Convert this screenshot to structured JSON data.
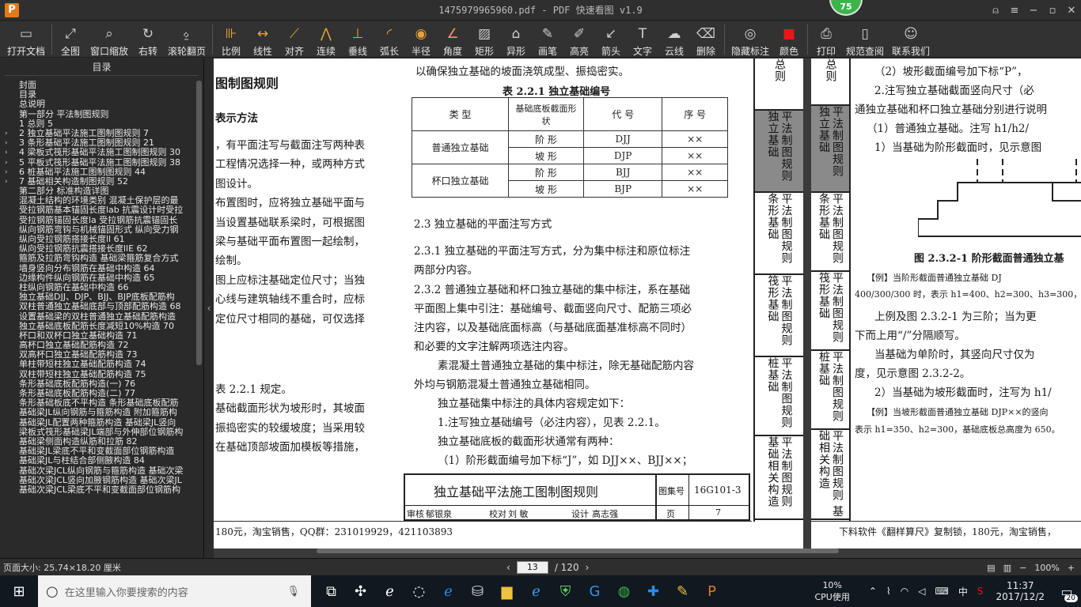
{
  "window": {
    "title": "1475979965960.pdf - PDF 快速看图 v1.9",
    "badge": "75"
  },
  "toolbar": [
    {
      "label": "打开文档",
      "icon": "folder-icon",
      "glyph": "▭"
    },
    {
      "label": "全图",
      "icon": "fit-page-icon",
      "glyph": "⤢"
    },
    {
      "label": "窗口缩放",
      "icon": "zoom-window-icon",
      "glyph": "⌕"
    },
    {
      "label": "右转",
      "icon": "rotate-right-icon",
      "glyph": "↻"
    },
    {
      "label": "滚轮翻页",
      "icon": "mouse-wheel-icon",
      "glyph": "⍚"
    },
    {
      "label": "比例",
      "icon": "scale-icon",
      "glyph": "⊪"
    },
    {
      "label": "线性",
      "icon": "linear-icon",
      "glyph": "↔"
    },
    {
      "label": "对齐",
      "icon": "align-icon",
      "glyph": "⟋"
    },
    {
      "label": "连续",
      "icon": "continuous-icon",
      "glyph": "⋀"
    },
    {
      "label": "垂线",
      "icon": "perpendicular-icon",
      "glyph": "⊥"
    },
    {
      "label": "弧长",
      "icon": "arc-length-icon",
      "glyph": "◜"
    },
    {
      "label": "半径",
      "icon": "radius-icon",
      "glyph": "◉"
    },
    {
      "label": "角度",
      "icon": "angle-icon",
      "glyph": "∠"
    },
    {
      "label": "矩形",
      "icon": "rectangle-icon",
      "glyph": "▨"
    },
    {
      "label": "异形",
      "icon": "polygon-icon",
      "glyph": "⌂"
    },
    {
      "label": "画笔",
      "icon": "pen-icon",
      "glyph": "✎"
    },
    {
      "label": "高亮",
      "icon": "highlighter-icon",
      "glyph": "✐"
    },
    {
      "label": "箭头",
      "icon": "arrow-icon",
      "glyph": "↙"
    },
    {
      "label": "文字",
      "icon": "text-icon",
      "glyph": "T"
    },
    {
      "label": "云线",
      "icon": "cloud-icon",
      "glyph": "☁"
    },
    {
      "label": "删除",
      "icon": "eraser-icon",
      "glyph": "⌫"
    },
    {
      "label": "隐藏标注",
      "icon": "hide-eye-icon",
      "glyph": "◎"
    },
    {
      "label": "颜色",
      "icon": "color-swatch-icon",
      "glyph": "■"
    },
    {
      "label": "打印",
      "icon": "printer-icon",
      "glyph": "⎙"
    },
    {
      "label": "规范查阅",
      "icon": "book-icon",
      "glyph": "▯"
    },
    {
      "label": "联系我们",
      "icon": "contact-icon",
      "glyph": "☺"
    }
  ],
  "colors": {
    "accent_orange": "#e8a23c",
    "color_red": "#e8161a",
    "badge_green": "#3cb44a"
  },
  "sidebar": {
    "title": "目录",
    "items": [
      {
        "t": "封面",
        "a": ""
      },
      {
        "t": "目录",
        "a": ""
      },
      {
        "t": "总说明",
        "a": ""
      },
      {
        "t": "第一部分  平法制图规则",
        "a": ""
      },
      {
        "t": "1 总则 5",
        "a": ""
      },
      {
        "t": "2 独立基础平法施工图制图规则 7",
        "a": "›"
      },
      {
        "t": "3 条形基础平法施工图制图规则 21",
        "a": "›"
      },
      {
        "t": "4 梁板式筏形基础平法施工图制图规则 30",
        "a": "›"
      },
      {
        "t": "5 平板式筏形基础平法施工图制图规则 38",
        "a": "›"
      },
      {
        "t": "6 桩基础平法施工图制图规则 44",
        "a": "›"
      },
      {
        "t": "7 基础相关构造制图规则 52",
        "a": "›"
      },
      {
        "t": "第二部分  标准构造详图",
        "a": ""
      },
      {
        "t": "混凝土结构的环境类别 混凝土保护层的最",
        "a": ""
      },
      {
        "t": "受拉钢筋基本锚固长度lab 抗震设计时受拉",
        "a": ""
      },
      {
        "t": "受拉钢筋锚固长度la 受拉钢筋抗震锚固长",
        "a": ""
      },
      {
        "t": "纵向钢筋弯钩与机械锚固形式 纵向受力钢",
        "a": ""
      },
      {
        "t": "纵向受拉钢筋搭接长度ll 61",
        "a": ""
      },
      {
        "t": "纵向受拉钢筋抗震搭接长度llE 62",
        "a": ""
      },
      {
        "t": "箍筋及拉筋弯钩构造 基础梁箍筋复合方式",
        "a": ""
      },
      {
        "t": "墙身竖向分布钢筋在基础中构造 64",
        "a": ""
      },
      {
        "t": "边缘构件纵向钢筋在基础中构造 65",
        "a": ""
      },
      {
        "t": "柱纵向钢筋在基础中构造 66",
        "a": ""
      },
      {
        "t": "独立基础DJJ、DJP、BJJ、BJP底板配筋构",
        "a": ""
      },
      {
        "t": "双柱普通独立基础底部与顶部配筋构造 68",
        "a": ""
      },
      {
        "t": "设置基础梁的双柱普通独立基础配筋构造",
        "a": ""
      },
      {
        "t": "独立基础底板配筋长度减短10%构造 70",
        "a": ""
      },
      {
        "t": "杯口和双杯口独立基础构造 71",
        "a": ""
      },
      {
        "t": "高杯口独立基础配筋构造 72",
        "a": ""
      },
      {
        "t": "双高杯口独立基础配筋构造 73",
        "a": ""
      },
      {
        "t": "单柱带短柱独立基础配筋构造 74",
        "a": ""
      },
      {
        "t": "双柱带短柱独立基础配筋构造 75",
        "a": ""
      },
      {
        "t": "条形基础底板配筋构造(一) 76",
        "a": ""
      },
      {
        "t": "条形基础底板配筋构造(二) 77",
        "a": ""
      },
      {
        "t": "条形基础板底不平构造 条形基础底板配筋",
        "a": ""
      },
      {
        "t": "基础梁JL纵向钢筋与箍筋构造 附加箍筋构",
        "a": ""
      },
      {
        "t": "基础梁JL配置两种箍筋构造 基础梁JL竖向",
        "a": ""
      },
      {
        "t": "梁板式筏形基础梁JL端部与外伸部位钢筋构",
        "a": ""
      },
      {
        "t": "基础梁侧面构造纵筋和拉筋 82",
        "a": ""
      },
      {
        "t": "基础梁JL梁底不平和变截面部位钢筋构造",
        "a": ""
      },
      {
        "t": "基础梁JL与柱结合部侧腋构造 84",
        "a": ""
      },
      {
        "t": "基础次梁JCL纵向钢筋与箍筋构造 基础次梁",
        "a": ""
      },
      {
        "t": "基础次梁JCL竖向加腋钢筋构造 基础次梁JL",
        "a": ""
      },
      {
        "t": "基础次梁JCL梁底不平和变截面部位钢筋构",
        "a": ""
      }
    ]
  },
  "page1": {
    "left_heading": "图制图规则",
    "left_sub": "表示方法",
    "left_lines": [
      "，有平面注写与截面注写两种表",
      "工程情况选择一种，或两种方式",
      "图设计。",
      "布置图时，应将独立基础平面与",
      "当设置基础联系梁时，可根据图",
      "梁与基础平面布置图一起绘制，",
      "绘制。",
      "图上应标注基础定位尺寸；当独",
      "心线与建筑轴线不重合时，应标",
      "定位尺寸相同的基础，可仅选择"
    ],
    "left_lines2": [
      "表 2.2.1 规定。",
      "基础截面形状为坡形时，其坡面",
      "振捣密实的较缓坡度；当采用较",
      "在基础顶部坡面加模板等措施，"
    ],
    "top_line": "以确保独立基础的坡面浇筑成型、振捣密实。",
    "table_title": "表 2.2.1    独立基础编号",
    "table_header": [
      "类  型",
      "基础底板截面形状",
      "代  号",
      "序  号"
    ],
    "table_rows": [
      {
        "type": "普通独立基础",
        "shape": "阶  形",
        "code": "DJJ",
        "seq": "××"
      },
      {
        "type": "",
        "shape": "坡  形",
        "code": "DJP",
        "seq": "××"
      },
      {
        "type": "杯口独立基础",
        "shape": "阶  形",
        "code": "BJJ",
        "seq": "××"
      },
      {
        "type": "",
        "shape": "坡  形",
        "code": "BJP",
        "seq": "××"
      }
    ],
    "section_23": "2.3  独立基础的平面注写方式",
    "p231a": "2.3.1  独立基础的平面注写方式，分为集中标注和原位标注",
    "p231b": "两部分内容。",
    "p232a": "2.3.2  普通独立基础和杯口独立基础的集中标注，系在基础",
    "p232b": "平面图上集中引注：基础编号、截面竖向尺寸、配筋三项必",
    "p232c": "注内容，以及基础底面标高（与基础底面基准标高不同时）",
    "p232d": "和必要的文字注解两项选注内容。",
    "p233a": "素混凝土普通独立基础的集中标注，除无基础配筋内容",
    "p233b": "外均与钢筋混凝土普通独立基础相同。",
    "p234": "独立基础集中标注的具体内容规定如下：",
    "p235": "1.注写独立基础编号（必注内容），见表 2.2.1。",
    "p236": "独立基础底板的截面形状通常有两种：",
    "p237": "（1）阶形截面编号加下标“J”，如 DJJ××、BJJ××；",
    "footer_title": "独立基础平法施工图制图规则",
    "footer_atlas_label": "图集号",
    "footer_atlas_no": "16G101-3",
    "footer_review": "审核",
    "footer_reviewer": "郁银泉",
    "footer_check": "校对",
    "footer_checker": "刘  敏",
    "footer_design": "设计",
    "footer_designer": "高志强",
    "footer_page_label": "页",
    "footer_page_no": "7",
    "bottom_ad": "180元，淘宝销售，QQ群：231019929，421103893",
    "tabs": [
      "总则",
      "平法制图规则 独立基础",
      "平法制图规则 条形基础",
      "平法制图规则 筏形基础",
      "平法制图规则 桩基础",
      "平法制图规则 基础相关构造"
    ]
  },
  "page2": {
    "l1": "（2）坡形截面编号加下标“P”，",
    "l2": "2.注写独立基础截面竖向尺寸（必",
    "l3": "通独立基础和杯口独立基础分别进行说明",
    "l4": "（1）普通独立基础。注写 h1/h2/",
    "l5": "1）当基础为阶形截面时，见示意图",
    "fig": "图 2.3.2-1  阶形截面普通独立基",
    "ex1a": "【例】当阶形截面普通独立基础 DJ",
    "ex1b": "400/300/300 时，表示 h1=400、h2=300、h3=300，",
    "l6": "上例及图 2.3.2-1 为三阶；当为更",
    "l7": "下而上用“/”分隔顺写。",
    "l8": "当基础为单阶时，其竖向尺寸仅为",
    "l9": "度，见示意图 2.3.2-2。",
    "l10": "2）当基础为坡形截面时，注写为 h1/",
    "ex2a": "【例】当坡形截面普通独立基础 DJP××的竖向",
    "ex2b": "表示 h1=350、h2=300，基础底板总高度为 650。",
    "bottom_ad": "下料软件《翻样算尺》复制锁，180元，淘宝销售，",
    "tabs": [
      "总则",
      "平法制图规则 独立基础",
      "平法制图规则 条形基础",
      "平法制图规则 筏形基础",
      "平法制图规则 桩基础",
      "平法制图规则 基础相关构造"
    ]
  },
  "status": {
    "page_size": "页面大小: 25.74×18.20 厘米",
    "current_page": "13",
    "total_pages": "/ 120",
    "zoom": "100%"
  },
  "taskbar": {
    "search_placeholder": "在这里输入你要搜索的内容",
    "cpu_percent": "10%",
    "cpu_label": "CPU使用",
    "ime": "中",
    "time": "11:37",
    "date": "2017/12/2",
    "notifications": "20"
  }
}
